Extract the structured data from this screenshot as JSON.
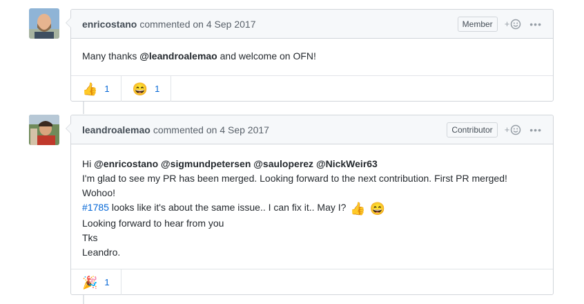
{
  "comments": [
    {
      "author": "enricostano",
      "action": "commented on 4 Sep 2017",
      "badge": "Member",
      "add_reaction": "+",
      "more": "•••",
      "body": {
        "prefix": "Many thanks ",
        "mention": "@leandroalemao",
        "suffix": " and welcome on OFN!"
      },
      "reactions": [
        {
          "emoji": "👍",
          "icon": "thumbs-up",
          "count": "1"
        },
        {
          "emoji": "😄",
          "icon": "smile",
          "count": "1"
        }
      ]
    },
    {
      "author": "leandroalemao",
      "action": "commented on 4 Sep 2017",
      "badge": "Contributor",
      "add_reaction": "+",
      "more": "•••",
      "body": {
        "hi": "Hi ",
        "mentions": [
          "@enricostano",
          "@sigmundpetersen",
          "@sauloperez",
          "@NickWeir63"
        ],
        "line2": "I'm glad to see my PR has been merged. Looking forward to the next contribution. First PR merged!",
        "line3": "Wohoo!",
        "issue_link": "#1785",
        "line4_rest": " looks like it's about the same issue.. I can fix it.. May I?",
        "line4_emojis": [
          "👍",
          "😄"
        ],
        "line5": "Looking forward to hear from you",
        "line6": "Tks",
        "line7": "Leandro."
      },
      "reactions": [
        {
          "emoji": "🎉",
          "icon": "tada",
          "count": "1"
        }
      ]
    }
  ],
  "colors": {
    "link": "#0366d6",
    "border": "#d1d5da",
    "header_bg": "#f6f8fa"
  }
}
